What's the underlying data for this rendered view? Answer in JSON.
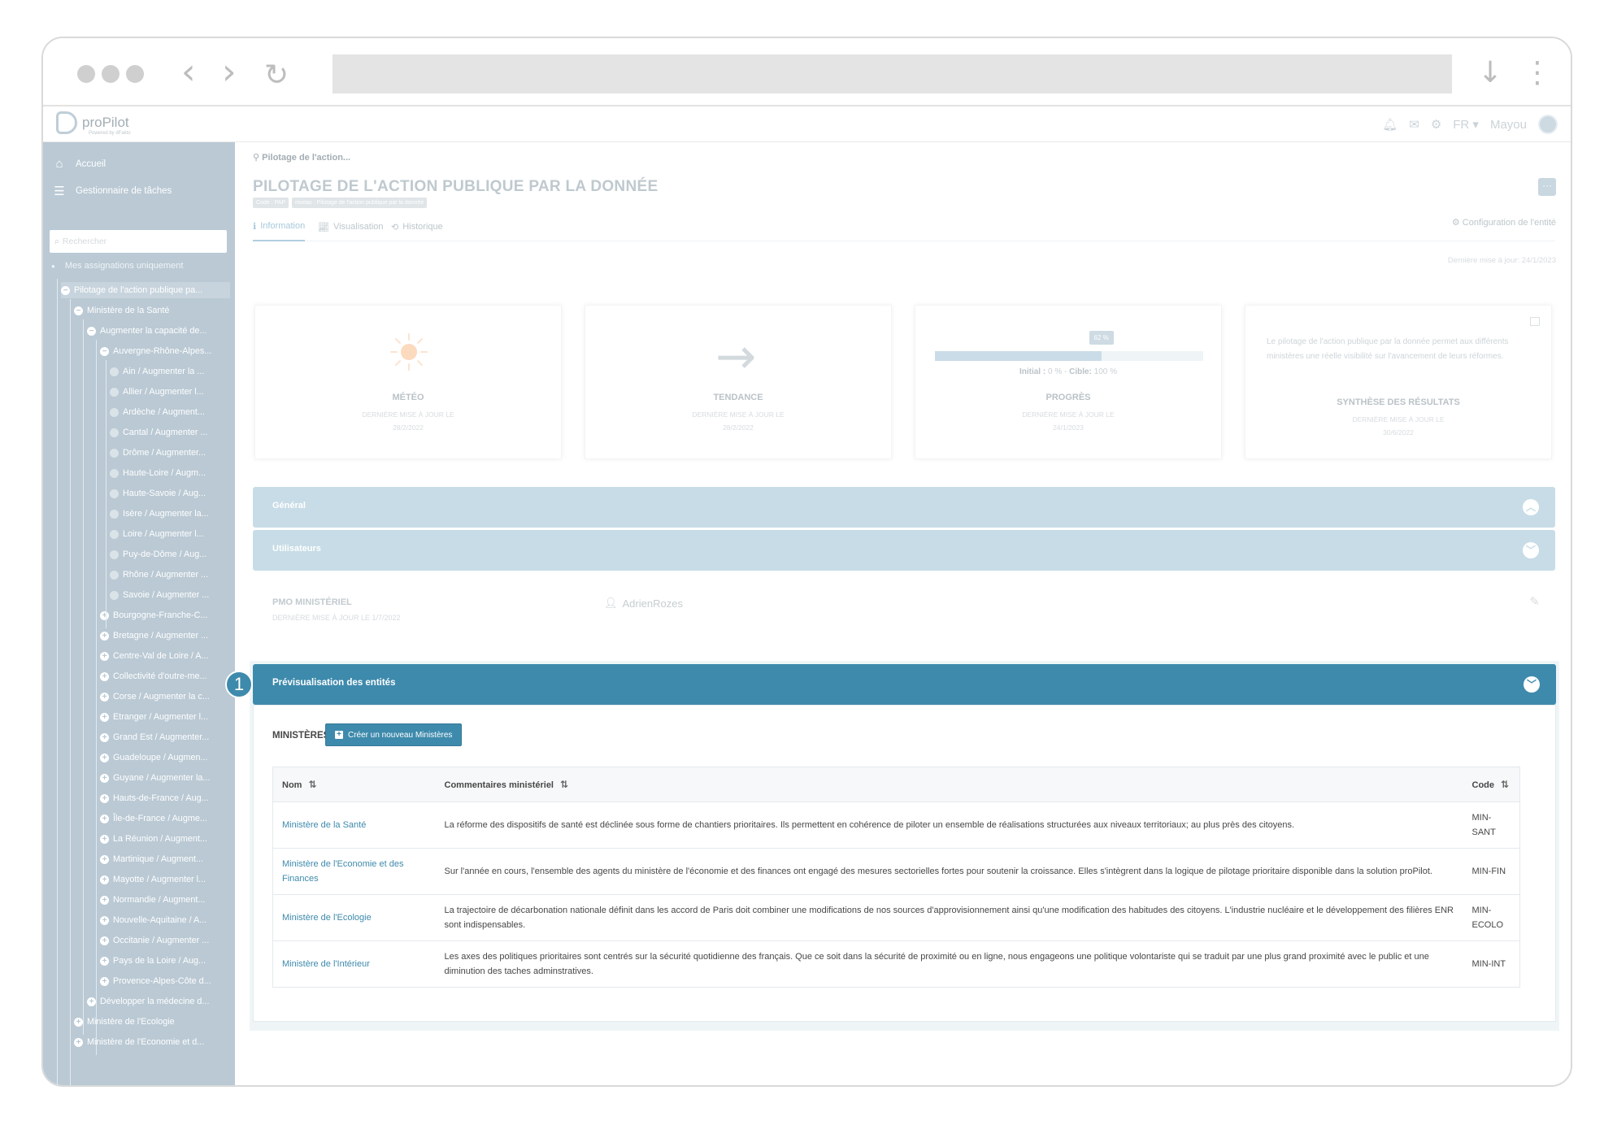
{
  "app": {
    "logo_text": "proPilot",
    "logo_sub": "Powered by dFakto",
    "lang": "FR",
    "user": "Mayou"
  },
  "sidebar": {
    "menu": [
      {
        "label": "Accueil",
        "icon": "home-icon"
      },
      {
        "label": "Gestionnaire de tâches",
        "icon": "task-list-icon"
      }
    ],
    "search_placeholder": "Rechercher",
    "filter_label": "Mes assignations uniquement",
    "tree": [
      {
        "label": "Pilotage de l'action publique pa...",
        "depth": 0,
        "kind": "open",
        "selected": true
      },
      {
        "label": "Ministère de la Santé",
        "depth": 1,
        "kind": "open"
      },
      {
        "label": "Augmenter la capacité de...",
        "depth": 2,
        "kind": "open"
      },
      {
        "label": "Auvergne-Rhône-Alpes...",
        "depth": 3,
        "kind": "open"
      },
      {
        "label": "Ain / Augmenter la ...",
        "depth": 4,
        "kind": "leaf"
      },
      {
        "label": "Allier / Augmenter l...",
        "depth": 4,
        "kind": "leaf"
      },
      {
        "label": "Ardèche / Augment...",
        "depth": 4,
        "kind": "leaf"
      },
      {
        "label": "Cantal / Augmenter ...",
        "depth": 4,
        "kind": "leaf"
      },
      {
        "label": "Drôme / Augmenter...",
        "depth": 4,
        "kind": "leaf"
      },
      {
        "label": "Haute-Loire / Augm...",
        "depth": 4,
        "kind": "leaf"
      },
      {
        "label": "Haute-Savoie / Aug...",
        "depth": 4,
        "kind": "leaf"
      },
      {
        "label": "Isère / Augmenter la...",
        "depth": 4,
        "kind": "leaf"
      },
      {
        "label": "Loire / Augmenter l...",
        "depth": 4,
        "kind": "leaf"
      },
      {
        "label": "Puy-de-Dôme / Aug...",
        "depth": 4,
        "kind": "leaf"
      },
      {
        "label": "Rhône / Augmenter ...",
        "depth": 4,
        "kind": "leaf"
      },
      {
        "label": "Savoie / Augmenter ...",
        "depth": 4,
        "kind": "leaf"
      },
      {
        "label": "Bourgogne-Franche-C...",
        "depth": 3,
        "kind": "closed"
      },
      {
        "label": "Bretagne / Augmenter ...",
        "depth": 3,
        "kind": "closed"
      },
      {
        "label": "Centre-Val de Loire / A...",
        "depth": 3,
        "kind": "closed"
      },
      {
        "label": "Collectivité d'outre-me...",
        "depth": 3,
        "kind": "closed"
      },
      {
        "label": "Corse / Augmenter la c...",
        "depth": 3,
        "kind": "closed"
      },
      {
        "label": "Etranger / Augmenter l...",
        "depth": 3,
        "kind": "closed"
      },
      {
        "label": "Grand Est / Augmenter...",
        "depth": 3,
        "kind": "closed"
      },
      {
        "label": "Guadeloupe / Augmen...",
        "depth": 3,
        "kind": "closed"
      },
      {
        "label": "Guyane / Augmenter la...",
        "depth": 3,
        "kind": "closed"
      },
      {
        "label": "Hauts-de-France / Aug...",
        "depth": 3,
        "kind": "closed"
      },
      {
        "label": "Île-de-France / Augme...",
        "depth": 3,
        "kind": "closed"
      },
      {
        "label": "La Réunion / Augment...",
        "depth": 3,
        "kind": "closed"
      },
      {
        "label": "Martinique / Augment...",
        "depth": 3,
        "kind": "closed"
      },
      {
        "label": "Mayotte / Augmenter l...",
        "depth": 3,
        "kind": "closed"
      },
      {
        "label": "Normandie / Augment...",
        "depth": 3,
        "kind": "closed"
      },
      {
        "label": "Nouvelle-Aquitaine / A...",
        "depth": 3,
        "kind": "closed"
      },
      {
        "label": "Occitanie / Augmenter ...",
        "depth": 3,
        "kind": "closed"
      },
      {
        "label": "Pays de la Loire / Aug...",
        "depth": 3,
        "kind": "closed"
      },
      {
        "label": "Provence-Alpes-Côte d...",
        "depth": 3,
        "kind": "closed"
      },
      {
        "label": "Développer la médecine d...",
        "depth": 2,
        "kind": "closed"
      },
      {
        "label": "Ministère de l'Ecologie",
        "depth": 1,
        "kind": "closed"
      },
      {
        "label": "Ministère de l'Economie et d...",
        "depth": 1,
        "kind": "closed"
      }
    ]
  },
  "page": {
    "breadcrumb": "Pilotage de l'action...",
    "title": "PILOTAGE DE L'ACTION PUBLIQUE PAR LA DONNÉE",
    "chip_code": "Code : PAP",
    "chip_level": "niveau : Pilotage de l'action publique par la donnée",
    "more_label": "···",
    "tabs": [
      {
        "label": "Information",
        "icon": "info-icon",
        "active": true
      },
      {
        "label": "Visualisation",
        "icon": "chart-icon",
        "active": false
      },
      {
        "label": "Historique",
        "icon": "history-icon",
        "active": false
      }
    ],
    "config_label": "Configuration de l'entité",
    "last_update": "Dernière mise à jour: 24/1/2023"
  },
  "cards": {
    "meteo": {
      "title": "MÉTÉO",
      "sub1": "DERNIÈRE MISE À JOUR LE",
      "sub2": "28/2/2022"
    },
    "tendance": {
      "title": "TENDANCE",
      "sub1": "DERNIÈRE MISE À JOUR LE",
      "sub2": "28/2/2022"
    },
    "progres": {
      "title": "PROGRÈS",
      "sub1": "DERNIÈRE MISE À JOUR LE",
      "sub2": "24/1/2023",
      "bubble": "62 %",
      "progress_fraction": 0.62,
      "initial_label": "Initial :",
      "initial_value": "0 %",
      "cible_label": "Cible:",
      "cible_value": "100 %"
    },
    "synthese": {
      "text": "Le pilotage de l'action publique par la donnée permet aux différents ministères une réelle visibilité sur l'avancement de leurs réformes.",
      "title": "SYNTHÈSE DES RÉSULTATS",
      "sub1": "DERNIÈRE MISE À JOUR LE",
      "sub2": "30/6/2022"
    }
  },
  "panels": {
    "general": "Général",
    "utilisateurs": "Utilisateurs",
    "pmo_label": "PMO MINISTÉRIEL",
    "pmo_date": "DERNIÈRE MISE À JOUR LE 1/7/2022",
    "pmo_user": "AdrienRozes"
  },
  "preview": {
    "step": "1",
    "title": "Prévisualisation des entités",
    "section_title": "MINISTÈRES",
    "create_label": "Créer un nouveau Ministères",
    "columns": [
      "Nom",
      "Commentaires ministériel",
      "Code"
    ],
    "rows": [
      {
        "name": "Ministère de la Santé",
        "comment": "La réforme des dispositifs de santé est déclinée sous forme de chantiers prioritaires. Ils permettent en cohérence de piloter un ensemble de réalisations structurées aux niveaux territoriaux; au plus près des citoyens.",
        "code": "MIN-SANT"
      },
      {
        "name": "Ministère de l'Economie et des Finances",
        "comment": "Sur l'année en cours, l'ensemble des agents du ministère de l'économie et des finances ont engagé des mesures sectorielles fortes pour soutenir la croissance. Elles s'intègrent dans la logique de pilotage prioritaire disponible dans la solution proPilot.",
        "code": "MIN-FIN"
      },
      {
        "name": "Ministère de l'Ecologie",
        "comment": "La trajectoire de décarbonation nationale définit dans les accord de Paris doit combiner une modifications de nos sources d'approvisionnement ainsi qu'une modification des habitudes des citoyens. L'industrie nucléaire et le développement des filières ENR sont indispensables.",
        "code": "MIN-ECOLO"
      },
      {
        "name": "Ministère de l'Intérieur",
        "comment": "Les axes des politiques prioritaires sont centrés sur la sécurité quotidienne des français. Que ce soit dans la sécurité de proximité ou en ligne, nous engageons une politique volontariste qui se traduit par une plus grand proximité avec le public et une diminution des taches adminstratives.",
        "code": "MIN-INT"
      }
    ]
  }
}
